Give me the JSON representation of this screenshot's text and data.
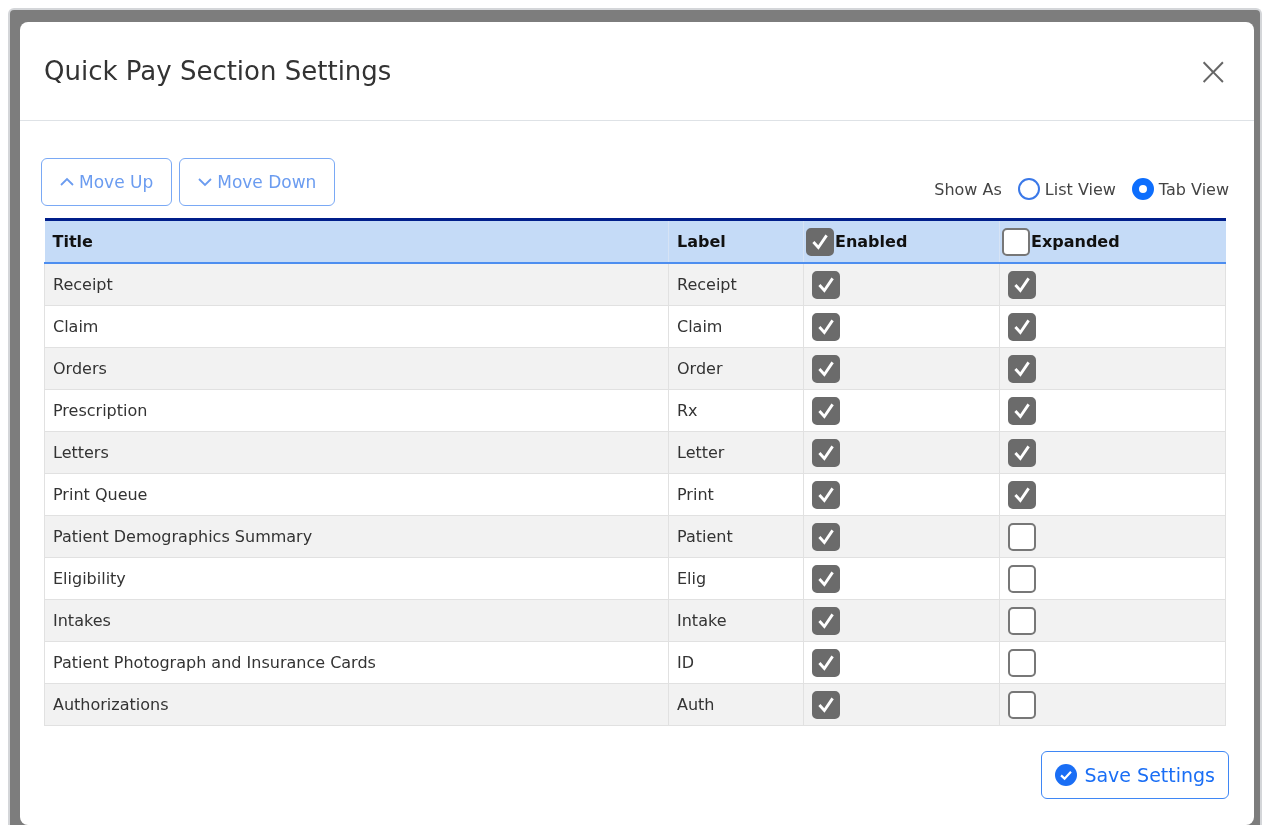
{
  "dialog": {
    "title": "Quick Pay Section Settings",
    "close_label": "×"
  },
  "buttons": [
    {
      "kind": "up",
      "label": "Move Up"
    },
    {
      "kind": "down",
      "label": "Move Down"
    }
  ],
  "show_as": {
    "label": "Show As",
    "options": [
      {
        "label": "List View",
        "selected": false
      },
      {
        "label": "Tab View",
        "selected": true
      }
    ]
  },
  "table": {
    "columns": [
      {
        "label": "Title"
      },
      {
        "label": "Label"
      },
      {
        "label": "Enabled",
        "checked": true
      },
      {
        "label": "Expanded",
        "checked": false
      }
    ],
    "rows": [
      {
        "title": "Receipt",
        "label": "Receipt",
        "enabled": true,
        "expanded": true
      },
      {
        "title": "Claim",
        "label": "Claim",
        "enabled": true,
        "expanded": true
      },
      {
        "title": "Orders",
        "label": "Order",
        "enabled": true,
        "expanded": true
      },
      {
        "title": "Prescription",
        "label": "Rx",
        "enabled": true,
        "expanded": true
      },
      {
        "title": "Letters",
        "label": "Letter",
        "enabled": true,
        "expanded": true
      },
      {
        "title": "Print Queue",
        "label": "Print",
        "enabled": true,
        "expanded": true
      },
      {
        "title": "Patient Demographics Summary",
        "label": "Patient",
        "enabled": true,
        "expanded": false
      },
      {
        "title": "Eligibility",
        "label": "Elig",
        "enabled": true,
        "expanded": false
      },
      {
        "title": "Intakes",
        "label": "Intake",
        "enabled": true,
        "expanded": false
      },
      {
        "title": "Patient Photograph and Insurance Cards",
        "label": "ID",
        "enabled": true,
        "expanded": false
      },
      {
        "title": "Authorizations",
        "label": "Auth",
        "enabled": true,
        "expanded": false
      }
    ]
  },
  "save_button": {
    "label": "Save Settings"
  }
}
